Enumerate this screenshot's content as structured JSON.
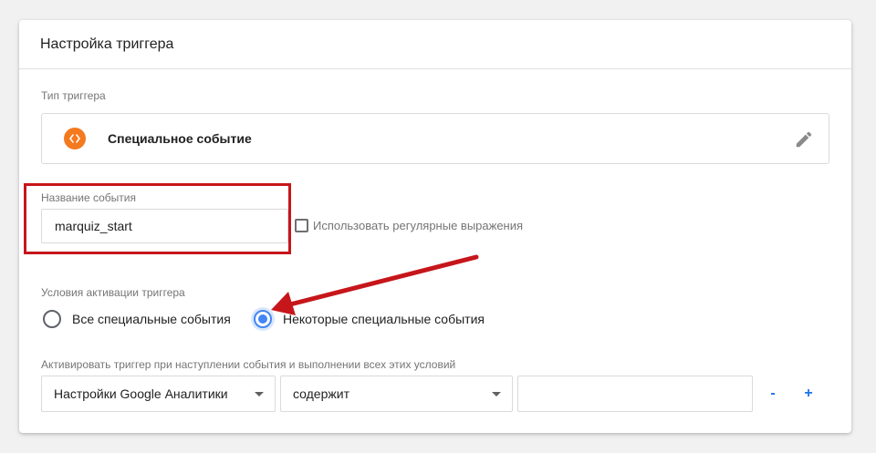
{
  "header": {
    "title": "Настройка триггера"
  },
  "trigger_type": {
    "label": "Тип триггера",
    "name": "Специальное событие",
    "icon": "custom-event-icon",
    "icon_color": "#f4791f"
  },
  "event_name": {
    "label": "Название события",
    "value": "marquiz_start",
    "regex_checkbox": {
      "label": "Использовать регулярные выражения",
      "checked": false
    }
  },
  "activation": {
    "label": "Условия активации триггера",
    "options": [
      {
        "label": "Все специальные события",
        "selected": false
      },
      {
        "label": "Некоторые специальные события",
        "selected": true
      }
    ]
  },
  "conditions": {
    "label": "Активировать триггер при наступлении события и выполнении всех этих условий",
    "variable": "Настройки Google Аналитики",
    "operator": "содержит",
    "value": "",
    "remove_label": "-",
    "add_label": "+"
  },
  "colors": {
    "accent": "#4285f4",
    "highlight": "#c6161b",
    "button_text": "#1a73e8"
  }
}
